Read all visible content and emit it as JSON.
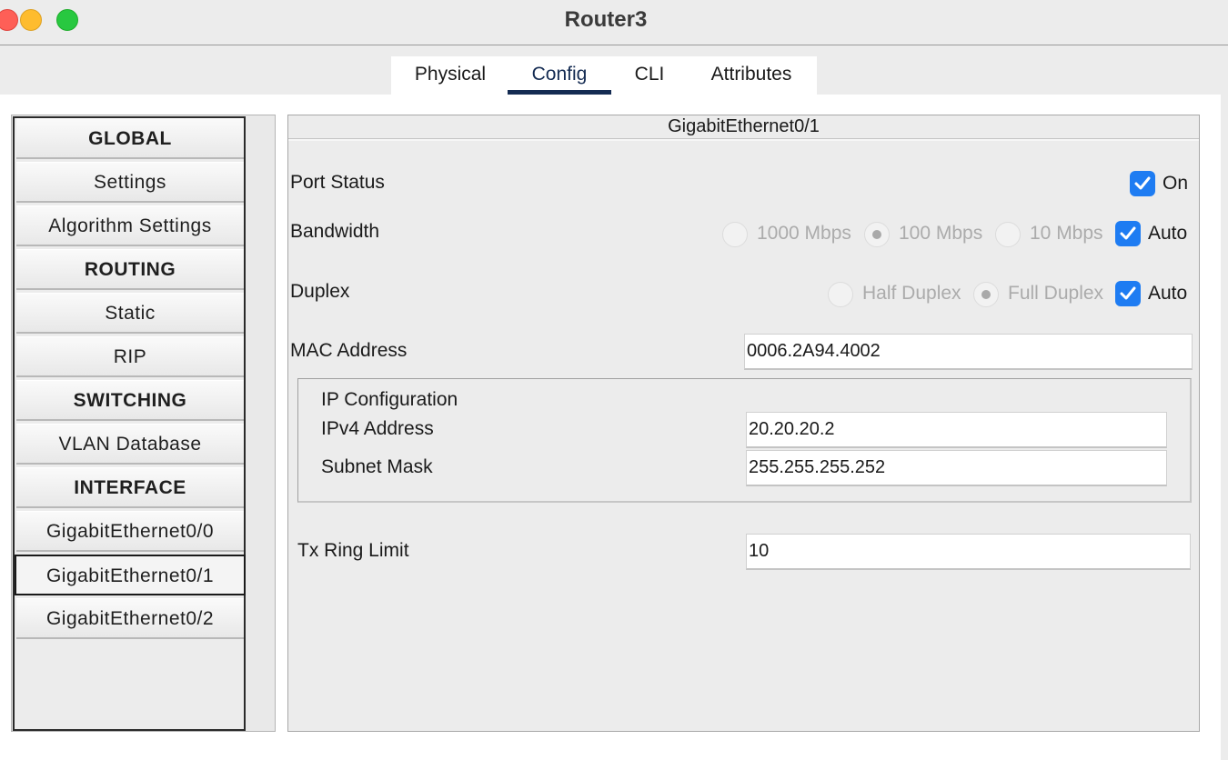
{
  "window": {
    "title": "Router3"
  },
  "tabs": [
    {
      "label": "Physical"
    },
    {
      "label": "Config"
    },
    {
      "label": "CLI"
    },
    {
      "label": "Attributes"
    }
  ],
  "active_tab": "Config",
  "sidebar": {
    "items": [
      {
        "label": "GLOBAL",
        "kind": "header"
      },
      {
        "label": "Settings",
        "kind": "item"
      },
      {
        "label": "Algorithm Settings",
        "kind": "item"
      },
      {
        "label": "ROUTING",
        "kind": "header"
      },
      {
        "label": "Static",
        "kind": "item"
      },
      {
        "label": "RIP",
        "kind": "item"
      },
      {
        "label": "SWITCHING",
        "kind": "header"
      },
      {
        "label": "VLAN Database",
        "kind": "item"
      },
      {
        "label": "INTERFACE",
        "kind": "header"
      },
      {
        "label": "GigabitEthernet0/0",
        "kind": "item"
      },
      {
        "label": "GigabitEthernet0/1",
        "kind": "item",
        "selected": true
      },
      {
        "label": "GigabitEthernet0/2",
        "kind": "item"
      }
    ]
  },
  "panel": {
    "title": "GigabitEthernet0/1",
    "port_status": {
      "label": "Port Status",
      "checkbox_label": "On",
      "checked": true
    },
    "bandwidth": {
      "label": "Bandwidth",
      "options": [
        "1000 Mbps",
        "100 Mbps",
        "10 Mbps"
      ],
      "selected": "100 Mbps",
      "auto_label": "Auto",
      "auto_checked": true
    },
    "duplex": {
      "label": "Duplex",
      "options": [
        "Half Duplex",
        "Full Duplex"
      ],
      "selected": "Full Duplex",
      "auto_label": "Auto",
      "auto_checked": true
    },
    "mac": {
      "label": "MAC Address",
      "value": "0006.2A94.4002"
    },
    "ip_config": {
      "title": "IP Configuration",
      "ipv4_label": "IPv4 Address",
      "ipv4_value": "20.20.20.2",
      "mask_label": "Subnet Mask",
      "mask_value": "255.255.255.252"
    },
    "tx_ring": {
      "label": "Tx Ring Limit",
      "value": "10"
    }
  },
  "colors": {
    "accent": "#1e7cf2",
    "tab_underline": "#142b52"
  }
}
